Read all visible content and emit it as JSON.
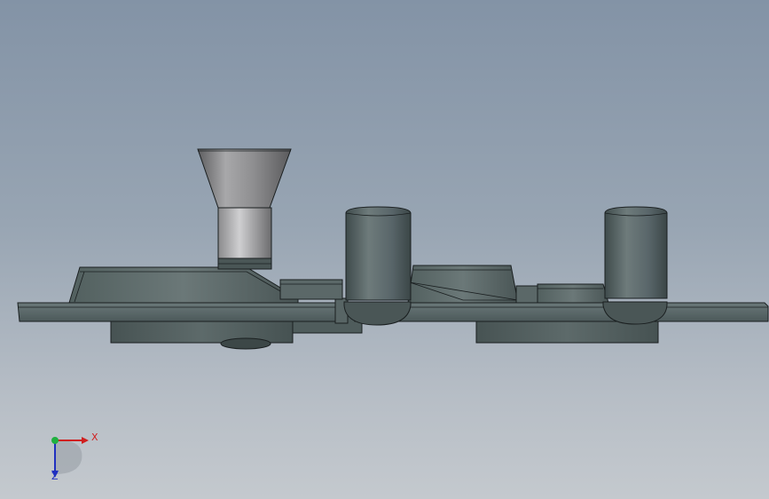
{
  "viewport": {
    "background_top": "#8393a6",
    "background_bottom": "#c4c9ce",
    "model_color": "#4e5c5e",
    "model_edge_color": "#1a1f20",
    "funnel_color": "#8a8a8c"
  },
  "triad": {
    "x_label": "X",
    "z_label": "Z",
    "x_color": "#d02020",
    "y_color": "#20b040",
    "z_color": "#2030c0"
  }
}
